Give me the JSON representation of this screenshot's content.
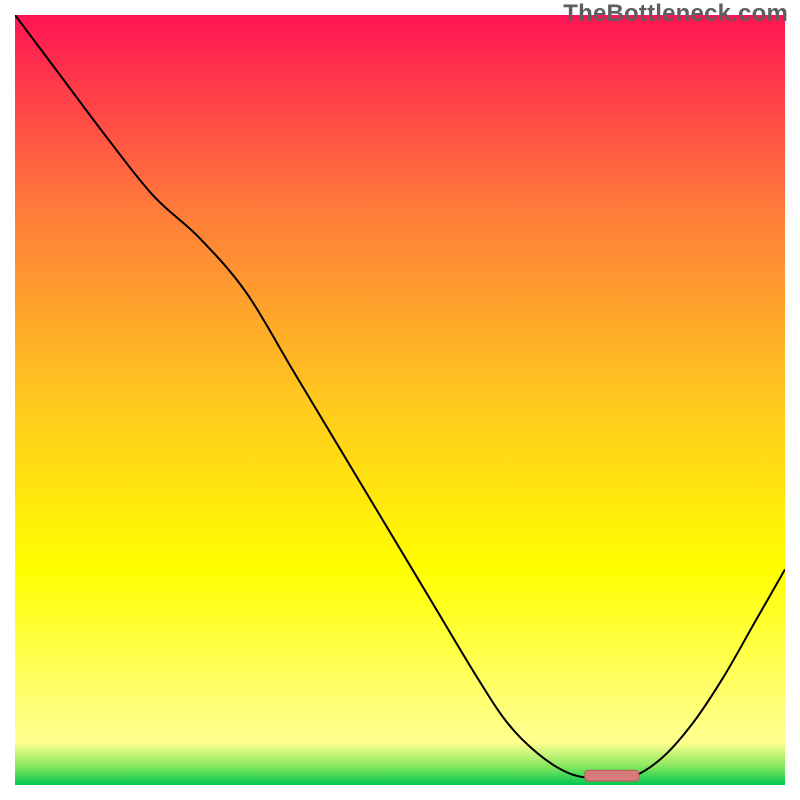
{
  "watermark": "TheBottleneck.com",
  "chart_data": {
    "type": "line",
    "title": "",
    "xlabel": "",
    "ylabel": "",
    "xlim": [
      0,
      100
    ],
    "ylim": [
      0,
      100
    ],
    "grid": false,
    "note": "No axis ticks or numeric labels are visible; x/y are normalized 0–100.",
    "background_gradient": {
      "type": "vertical",
      "stops": [
        {
          "pos": 0.0,
          "color": "#ff1452"
        },
        {
          "pos": 0.25,
          "color": "#ff7a3a"
        },
        {
          "pos": 0.5,
          "color": "#ffc81e"
        },
        {
          "pos": 0.72,
          "color": "#ffff00"
        },
        {
          "pos": 0.9,
          "color": "#ffff7a"
        },
        {
          "pos": 0.945,
          "color": "#ffff90"
        },
        {
          "pos": 0.975,
          "color": "#8ae85e"
        },
        {
          "pos": 1.0,
          "color": "#00c853"
        }
      ]
    },
    "series": [
      {
        "name": "curve",
        "color": "#000000",
        "width": 2,
        "x": [
          0,
          6,
          12,
          18,
          24,
          30,
          36,
          42,
          48,
          54,
          60,
          64,
          68,
          72,
          76,
          80,
          84,
          88,
          92,
          96,
          100
        ],
        "y": [
          100,
          92,
          84,
          76.5,
          71,
          64,
          54,
          44,
          34,
          24,
          14,
          8,
          4,
          1.5,
          0.8,
          1.0,
          3.5,
          8,
          14,
          21,
          28
        ]
      }
    ],
    "marker": {
      "name": "optimum-marker",
      "x_start": 74,
      "x_end": 81,
      "y": 1.2,
      "fill": "#d77a7a",
      "stroke": "#b85c5c",
      "rx": 3,
      "height_pct": 1.4
    }
  }
}
